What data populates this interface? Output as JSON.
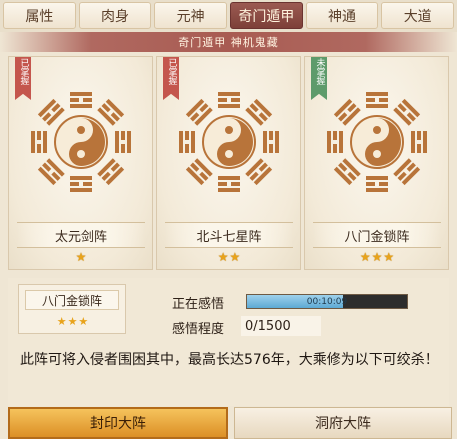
{
  "tabs": [
    {
      "label": "属性"
    },
    {
      "label": "肉身"
    },
    {
      "label": "元神"
    },
    {
      "label": "奇门遁甲",
      "active": true
    },
    {
      "label": "神通"
    },
    {
      "label": "大道"
    }
  ],
  "banner": "奇门遁甲  神机鬼藏",
  "formations": [
    {
      "name": "太元剑阵",
      "tag": "已掌握",
      "tag_color": "#c4564d",
      "stars": "★",
      "star_count": 1
    },
    {
      "name": "北斗七星阵",
      "tag": "已掌握",
      "tag_color": "#c4564d",
      "stars": "★★",
      "star_count": 2
    },
    {
      "name": "八门金锁阵",
      "tag": "未掌握",
      "tag_color": "#5e9b6b",
      "stars": "★★★",
      "star_count": 3
    }
  ],
  "detail": {
    "name": "八门金锁阵",
    "stars": "★★★",
    "comprehending_label": "正在感悟",
    "timer": "00:10:09",
    "progress_fraction": 0.6,
    "level_label": "感悟程度",
    "level_value": "0/1500",
    "description": "此阵可将入侵者围困其中，最高长达576年，大乘修为以下可绞杀！"
  },
  "bottom_tabs": {
    "seal": "封印大阵",
    "cave": "洞府大阵"
  },
  "colors": {
    "accent": "#9b5a52",
    "gold": "#e8a31b",
    "progress": "#5da9d4"
  }
}
